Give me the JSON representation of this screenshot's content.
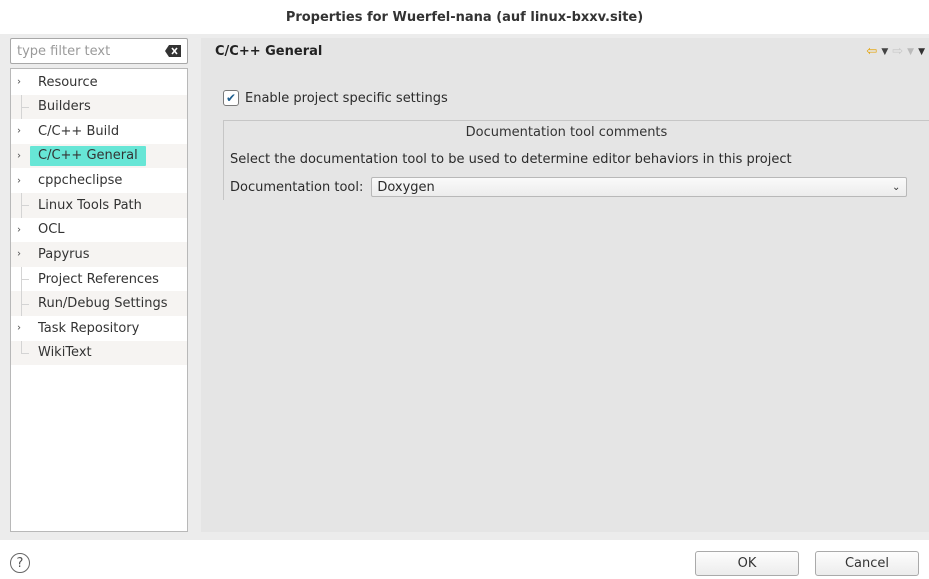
{
  "window": {
    "title": "Properties for Wuerfel-nana  (auf linux-bxxv.site)"
  },
  "filter": {
    "placeholder": "type filter text",
    "clear_icon": "clear-filter-icon"
  },
  "tree": {
    "items": [
      {
        "label": "Resource",
        "expandable": true
      },
      {
        "label": "Builders",
        "expandable": false
      },
      {
        "label": "C/C++ Build",
        "expandable": true
      },
      {
        "label": "C/C++ General",
        "expandable": true,
        "selected": true
      },
      {
        "label": "cppcheclipse",
        "expandable": true
      },
      {
        "label": "Linux Tools Path",
        "expandable": false
      },
      {
        "label": "OCL",
        "expandable": true
      },
      {
        "label": "Papyrus",
        "expandable": true
      },
      {
        "label": "Project References",
        "expandable": false
      },
      {
        "label": "Run/Debug Settings",
        "expandable": false
      },
      {
        "label": "Task Repository",
        "expandable": true
      },
      {
        "label": "WikiText",
        "expandable": false
      }
    ]
  },
  "page": {
    "title": "C/C++ General",
    "enable_specific": {
      "label": "Enable project specific settings",
      "checked": true
    },
    "group": {
      "title": "Documentation tool comments",
      "description": "Select the documentation tool to be used to determine editor behaviors in this project",
      "tool_label": "Documentation tool:",
      "tool_value": "Doxygen"
    }
  },
  "buttons": {
    "ok": "OK",
    "cancel": "Cancel",
    "help": "?"
  },
  "colors": {
    "selection": "#67e6d6",
    "back_arrow": "#e5a100"
  }
}
